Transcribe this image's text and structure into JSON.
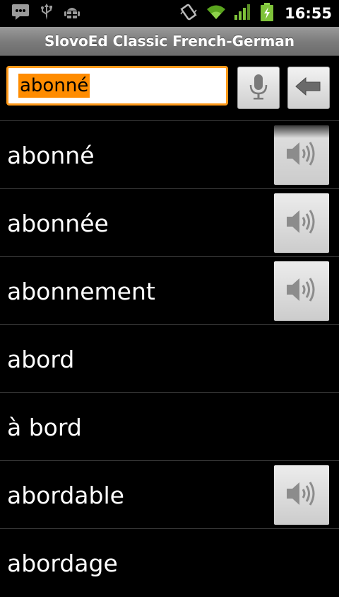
{
  "status_bar": {
    "time": "16:55",
    "left_icons": [
      "message-icon",
      "usb-icon",
      "android-debug-icon"
    ],
    "right_icons": [
      "vibrate-icon",
      "wifi-icon",
      "signal-icon",
      "battery-charging-icon"
    ]
  },
  "app": {
    "title": "SlovoEd Classic French-German"
  },
  "search": {
    "value": "abonné"
  },
  "words": [
    {
      "text": "abonné",
      "audio": true
    },
    {
      "text": "abonnée",
      "audio": true
    },
    {
      "text": "abonnement",
      "audio": true
    },
    {
      "text": "abord",
      "audio": false
    },
    {
      "text": "à bord",
      "audio": false
    },
    {
      "text": "abordable",
      "audio": true
    },
    {
      "text": "abordage",
      "audio": false
    }
  ],
  "colors": {
    "accent": "#ff8c00",
    "background": "#000000",
    "titlebar": "#8a8a8a"
  }
}
